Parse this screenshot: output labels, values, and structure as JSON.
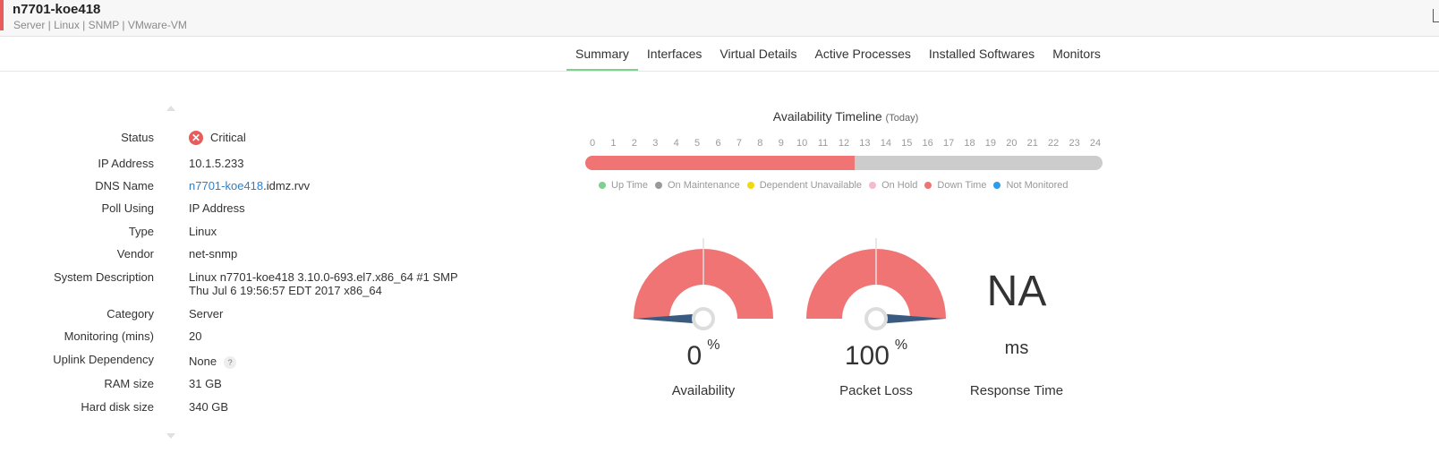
{
  "header": {
    "title": "n7701-koe418",
    "subtitle": "Server | Linux  | SNMP | VMware-VM"
  },
  "tabs": [
    {
      "label": "Summary",
      "active": true
    },
    {
      "label": "Interfaces",
      "active": false
    },
    {
      "label": "Virtual Details",
      "active": false
    },
    {
      "label": "Active Processes",
      "active": false
    },
    {
      "label": "Installed Softwares",
      "active": false
    },
    {
      "label": "Monitors",
      "active": false
    }
  ],
  "properties": {
    "status": {
      "label": "Status",
      "value": "Critical",
      "icon": "critical-x-icon"
    },
    "ip_address": {
      "label": "IP Address",
      "value": "10.1.5.233"
    },
    "dns_name": {
      "label": "DNS Name",
      "link": "n7701-koe418",
      "suffix": ".idmz.rvv"
    },
    "poll_using": {
      "label": "Poll Using",
      "value": "IP Address"
    },
    "type": {
      "label": "Type",
      "value": "Linux"
    },
    "vendor": {
      "label": "Vendor",
      "value": "net-snmp"
    },
    "system_description": {
      "label": "System Description",
      "line1": "Linux n7701-koe418 3.10.0-693.el7.x86_64 #1 SMP",
      "line2": "Thu Jul 6 19:56:57 EDT 2017 x86_64"
    },
    "category": {
      "label": "Category",
      "value": "Server"
    },
    "monitoring": {
      "label": "Monitoring (mins)",
      "value": "20"
    },
    "uplink": {
      "label": "Uplink Dependency",
      "value": "None",
      "help": "?"
    },
    "ram": {
      "label": "RAM size",
      "value": "31 GB"
    },
    "hdd": {
      "label": "Hard disk size",
      "value": "340 GB"
    }
  },
  "timeline": {
    "title": "Availability Timeline",
    "qualifier": "(Today)",
    "hours": [
      "0",
      "1",
      "2",
      "3",
      "4",
      "5",
      "6",
      "7",
      "8",
      "9",
      "10",
      "11",
      "12",
      "13",
      "14",
      "15",
      "16",
      "17",
      "18",
      "19",
      "20",
      "21",
      "22",
      "23",
      "24"
    ],
    "down_time_until_hour": 12.5,
    "colors": {
      "down": "#f07474",
      "rest": "#cccccc"
    },
    "legend": [
      {
        "label": "Up Time",
        "color": "#7fcf8f"
      },
      {
        "label": "On Maintenance",
        "color": "#999999"
      },
      {
        "label": "Dependent Unavailable",
        "color": "#f2d80f"
      },
      {
        "label": "On Hold",
        "color": "#f4bcc8"
      },
      {
        "label": "Down Time",
        "color": "#f07474"
      },
      {
        "label": "Not Monitored",
        "color": "#2e9de8"
      }
    ]
  },
  "gauges": {
    "availability": {
      "value": "0",
      "unit": "%",
      "label": "Availability",
      "level": 0
    },
    "packet_loss": {
      "value": "100",
      "unit": "%",
      "label": "Packet Loss",
      "level": 1
    }
  },
  "response_time": {
    "value": "NA",
    "unit": "ms",
    "label": "Response Time"
  }
}
